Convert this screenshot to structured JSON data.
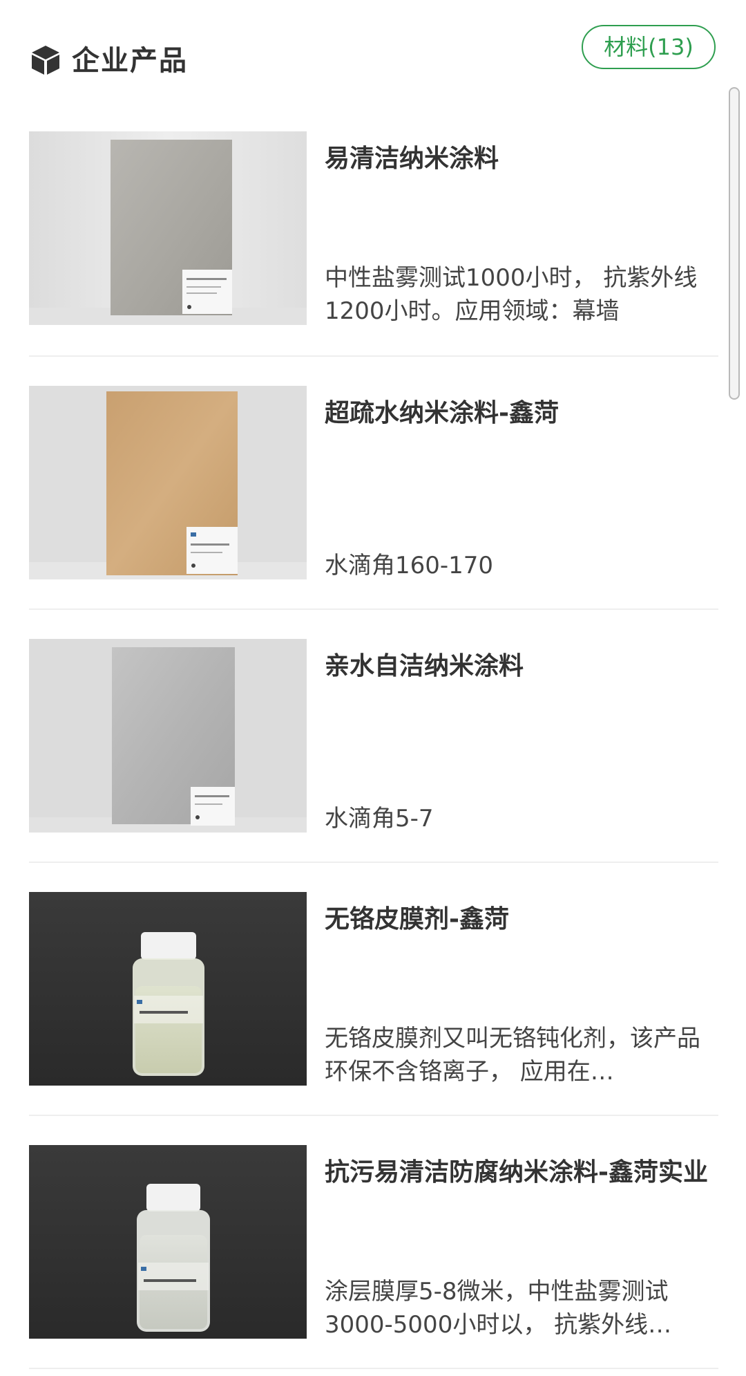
{
  "header": {
    "title": "企业产品",
    "icon": "cube-icon",
    "category_badge": "材料(13)",
    "accent_color": "#2e9e4f"
  },
  "products": [
    {
      "title": "易清洁纳米涂料",
      "description": "中性盐雾测试1000小时， 抗紫外线1200小时。应用领域：幕墙",
      "image": "silver-coated-panel"
    },
    {
      "title": "超疏水纳米涂料-鑫菏",
      "description": "水滴角160-170",
      "image": "tan-coated-panel"
    },
    {
      "title": "亲水自洁纳米涂料",
      "description": "水滴角5-7",
      "image": "silver-coated-panel"
    },
    {
      "title": "无铬皮膜剂-鑫菏",
      "description": "无铬皮膜剂又叫无铬钝化剂，该产品环保不含铬离子， 应用在…",
      "image": "liquid-bottle"
    },
    {
      "title": "抗污易清洁防腐纳米涂料-鑫菏实业",
      "description": "涂层膜厚5-8微米，中性盐雾测试3000-5000小时以， 抗紫外线…",
      "image": "liquid-bottle"
    }
  ]
}
